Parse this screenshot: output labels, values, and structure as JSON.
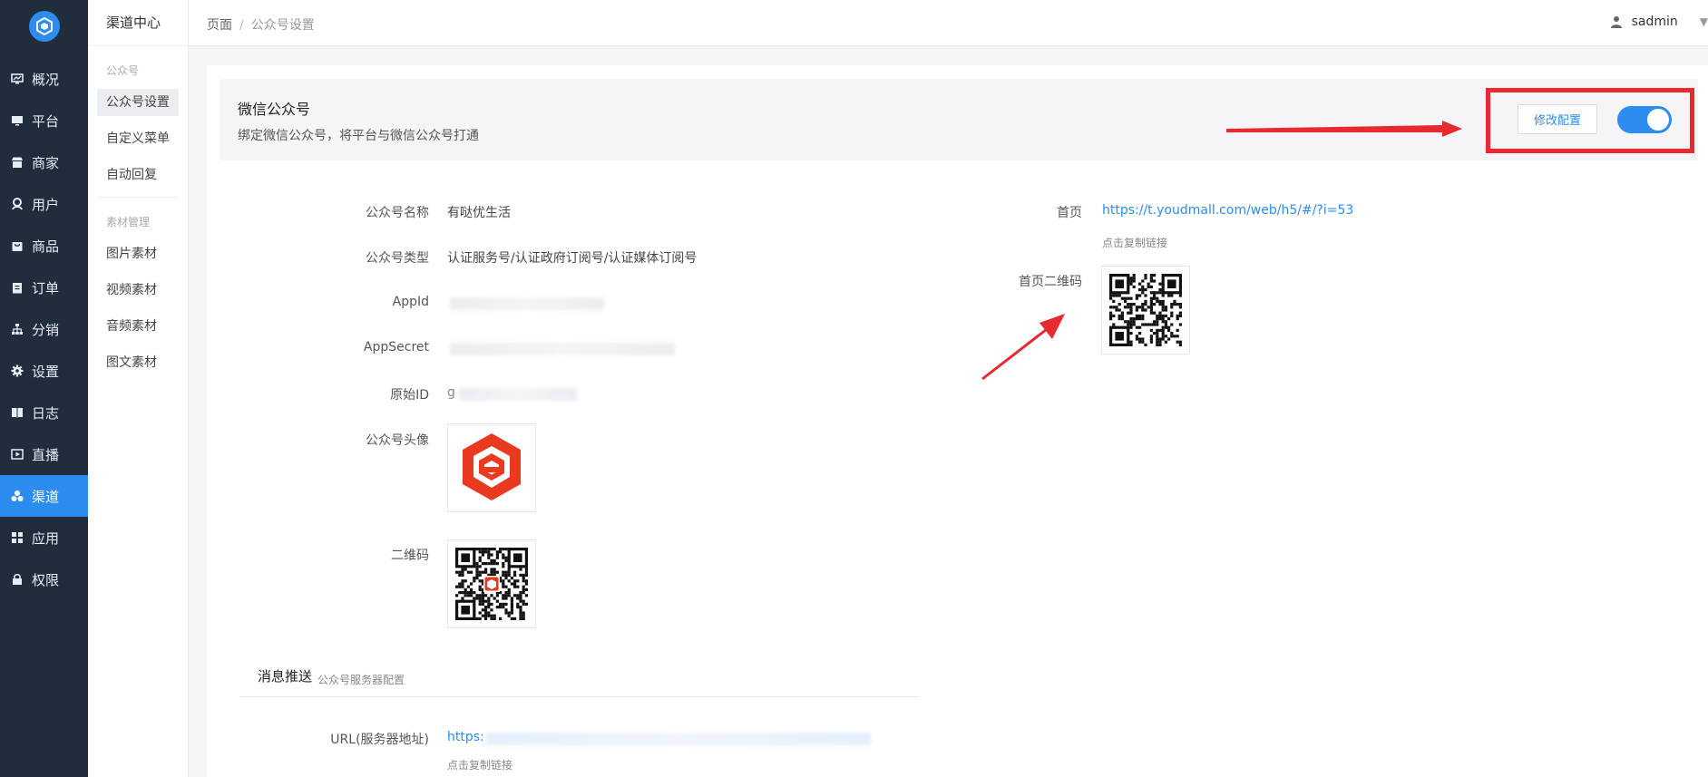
{
  "sidebar": {
    "items": [
      {
        "label": "概况",
        "icon": "monitor-icon"
      },
      {
        "label": "平台",
        "icon": "desktop-icon"
      },
      {
        "label": "商家",
        "icon": "store-icon"
      },
      {
        "label": "用户",
        "icon": "user-icon"
      },
      {
        "label": "商品",
        "icon": "bag-icon"
      },
      {
        "label": "订单",
        "icon": "clipboard-icon"
      },
      {
        "label": "分销",
        "icon": "sitemap-icon"
      },
      {
        "label": "设置",
        "icon": "gear-icon"
      },
      {
        "label": "日志",
        "icon": "book-icon"
      },
      {
        "label": "直播",
        "icon": "video-icon"
      },
      {
        "label": "渠道",
        "icon": "cluster-icon"
      },
      {
        "label": "应用",
        "icon": "grid-icon"
      },
      {
        "label": "权限",
        "icon": "lock-icon"
      }
    ],
    "active_index": 10
  },
  "submenu": {
    "title": "渠道中心",
    "group1": "公众号",
    "items1": [
      "公众号设置",
      "自定义菜单",
      "自动回复"
    ],
    "group2": "素材管理",
    "items2": [
      "图片素材",
      "视频素材",
      "音频素材",
      "图文素材"
    ]
  },
  "header": {
    "breadcrumb_root": "页面",
    "breadcrumb_sep": "/",
    "breadcrumb_current": "公众号设置",
    "username": "sadmin"
  },
  "card": {
    "title": "微信公众号",
    "desc": "绑定微信公众号，将平台与微信公众号打通",
    "edit_button": "修改配置",
    "enabled": true
  },
  "fields": {
    "name_label": "公众号名称",
    "name_value": "有哒优生活",
    "type_label": "公众号类型",
    "type_value": "认证服务号/认证政府订阅号/认证媒体订阅号",
    "appid_label": "AppId",
    "appsecret_label": "AppSecret",
    "origin_label": "原始ID",
    "origin_value_prefix": "g",
    "avatar_label": "公众号头像",
    "qrcode_label": "二维码"
  },
  "right": {
    "home_label": "首页",
    "home_url": "https://t.youdmall.com/web/h5/#/?i=53",
    "copy_hint": "点击复制链接",
    "home_qr_label": "首页二维码"
  },
  "push": {
    "title": "消息推送",
    "subtitle": "公众号服务器配置",
    "url_label": "URL(服务器地址)",
    "url_value_prefix": "https:",
    "copy_hint": "点击复制链接"
  },
  "colors": {
    "accent": "#2d8cf0",
    "sidebar_bg": "#1f2d3d",
    "annotation_red": "#e8292e",
    "avatar_red": "#e9391f"
  }
}
